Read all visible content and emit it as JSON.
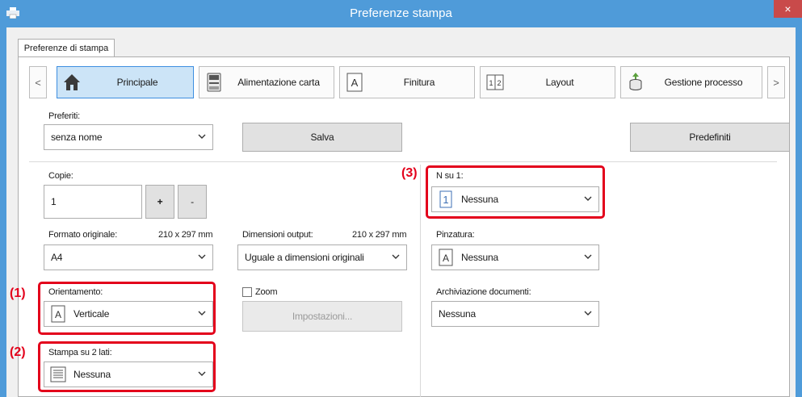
{
  "window": {
    "title": "Preferenze stampa",
    "close_glyph": "×"
  },
  "tabs": [
    {
      "label": "Preferenze di stampa"
    }
  ],
  "nav": {
    "prev_glyph": "<",
    "next_glyph": ">",
    "items": [
      {
        "label": "Principale",
        "icon": "home-icon",
        "active": true
      },
      {
        "label": "Alimentazione carta",
        "icon": "paper-tray-icon"
      },
      {
        "label": "Finitura",
        "icon": "finishing-icon"
      },
      {
        "label": "Layout",
        "icon": "layout-icon"
      },
      {
        "label": "Gestione processo",
        "icon": "job-handling-icon"
      }
    ]
  },
  "favorites": {
    "label": "Preferiti:",
    "value": "senza nome",
    "save_label": "Salva",
    "defaults_label": "Predefiniti"
  },
  "copies": {
    "label": "Copie:",
    "value": "1",
    "plus_label": "+",
    "minus_label": "-"
  },
  "original_size": {
    "label": "Formato originale:",
    "size": "210 x 297 mm",
    "value": "A4"
  },
  "output_size": {
    "label": "Dimensioni output:",
    "size": "210 x 297 mm",
    "value": "Uguale a dimensioni originali"
  },
  "orientation": {
    "label": "Orientamento:",
    "value": "Verticale",
    "icon_glyph": "A"
  },
  "zoom": {
    "label": "Zoom",
    "checked": false,
    "settings_label": "Impostazioni..."
  },
  "duplex": {
    "label": "Stampa su 2 lati:",
    "value": "Nessuna"
  },
  "n_up": {
    "label": "N su 1:",
    "value": "Nessuna",
    "icon_glyph": "1"
  },
  "stapling": {
    "label": "Pinzatura:",
    "value": "Nessuna",
    "icon_glyph": "A"
  },
  "document_filing": {
    "label": "Archiviazione documenti:",
    "value": "Nessuna"
  },
  "callouts": {
    "c1": "(1)",
    "c2": "(2)",
    "c3": "(3)"
  },
  "colors": {
    "title_bar": "#4f9bd9",
    "callout_red": "#e3001b",
    "active_nav": "#cce4f7"
  }
}
